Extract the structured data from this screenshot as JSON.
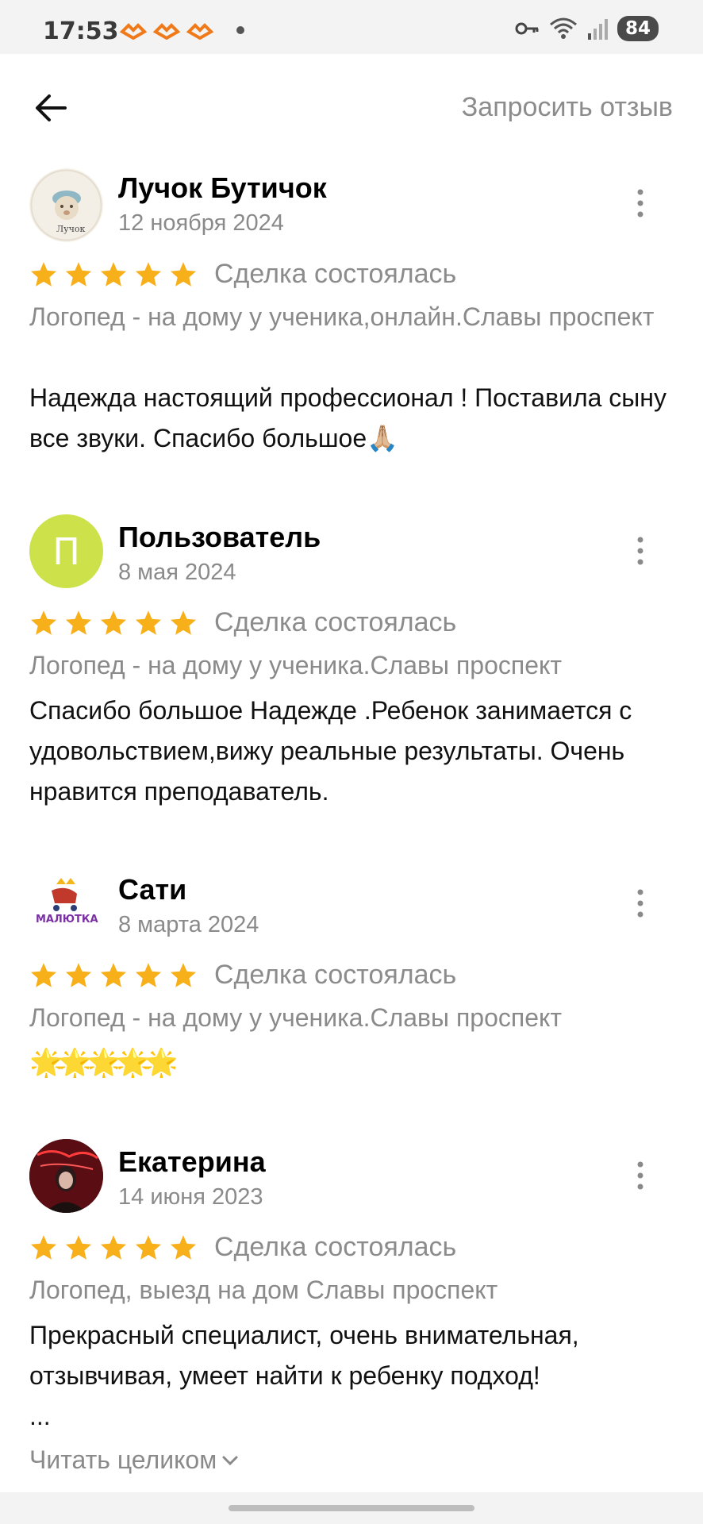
{
  "status_bar": {
    "time": "17:53",
    "battery": "84",
    "icons": [
      "vpn-key-icon",
      "wifi-icon",
      "signal-icon"
    ]
  },
  "header": {
    "back_icon": "arrow-left-icon",
    "request_review": "Запросить отзыв"
  },
  "colors": {
    "star": "#f8b01a",
    "muted": "#8a8a8a",
    "avatar_green": "#cde24a"
  },
  "reviews": [
    {
      "author": "Лучок Бутичок",
      "date": "12 ноября 2024",
      "rating": 5,
      "deal_status": "Сделка состоялась",
      "service": "Логопед - на дому у ученика,онлайн.Славы проспект",
      "text": "Надежда настоящий профессионал !  Поставила сыну все звуки. Спасибо большое🙏🏼"
    },
    {
      "author": "Пользователь",
      "avatar_letter": "П",
      "date": "8 мая 2024",
      "rating": 5,
      "deal_status": "Сделка состоялась",
      "service": "Логопед - на дому у ученика.Славы проспект",
      "text": "Спасибо большое Надежде .Ребенок занимается с удовольствием,вижу реальные результаты. Очень нравится преподаватель."
    },
    {
      "author": "Сати",
      "date": "8 марта 2024",
      "rating": 5,
      "deal_status": "Сделка состоялась",
      "service": "Логопед - на дому у ученика.Славы проспект",
      "text": "🌟🌟🌟🌟🌟"
    },
    {
      "author": "Екатерина",
      "date": "14 июня 2023",
      "rating": 5,
      "deal_status": "Сделка состоялась",
      "service": "Логопед, выезд на дом Славы проспект",
      "text": "Прекрасный специалист, очень внимательная, отзывчивая, умеет найти к ребенку подход!\n...",
      "read_more": "Читать целиком"
    }
  ]
}
